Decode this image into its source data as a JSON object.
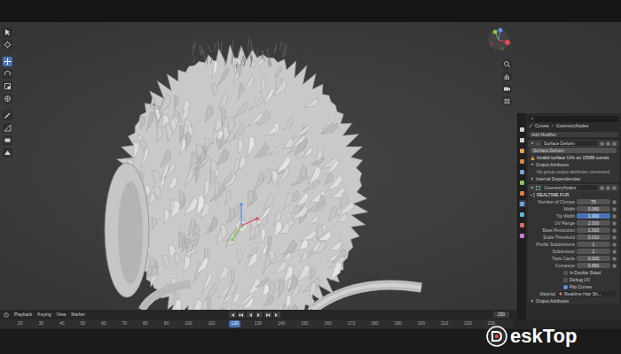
{
  "toolbar": {
    "tools": [
      {
        "selected": false
      },
      {
        "selected": false
      },
      {
        "selected": true
      },
      {
        "selected": false
      },
      {
        "selected": false
      },
      {
        "selected": false
      },
      {
        "selected": false
      },
      {
        "selected": false
      },
      {
        "selected": false
      },
      {
        "selected": false
      }
    ]
  },
  "properties": {
    "tabs": [
      {
        "color": "#cfcfcf",
        "selected": false
      },
      {
        "color": "#cfcfcf",
        "selected": false
      },
      {
        "color": "#e0a050",
        "selected": false
      },
      {
        "color": "#d08a4a",
        "selected": false
      },
      {
        "color": "#7fa4d6",
        "selected": false
      },
      {
        "color": "#8bbf6a",
        "selected": false
      },
      {
        "color": "#d87a3a",
        "selected": false
      },
      {
        "color": "#6e9ee0",
        "selected": true
      },
      {
        "color": "#5fb8d8",
        "selected": false
      },
      {
        "color": "#d46a6a",
        "selected": false
      },
      {
        "color": "#c77ad6",
        "selected": false
      }
    ],
    "breadcrumb": [
      "Curves",
      "GeometryNodes"
    ],
    "add_modifier": "Add Modifier",
    "surface_deform": {
      "name": "Surface Deform",
      "expanded": true,
      "target": "Surface Deform",
      "warning": "Invalid surface UVs on 15588 curves",
      "output_section": {
        "title": "Output Attributes",
        "expanded": true
      },
      "output_note": "No group output attributes connected",
      "dependencies": {
        "title": "Internal Dependencies",
        "expanded": false
      }
    },
    "geometry_nodes": {
      "name": "GeometryNodes",
      "expanded": true,
      "node_group": "REALTIME FUR",
      "inputs": [
        {
          "label": "Number of Clumps",
          "value": "70",
          "selected": false
        },
        {
          "label": "Width",
          "value": "0.060",
          "selected": false
        },
        {
          "label": "Tip Width",
          "value": "1.000",
          "selected": true
        },
        {
          "label": "UV Range",
          "value": "2.000",
          "selected": false
        },
        {
          "label": "Base Resolution",
          "value": "1.000",
          "selected": false
        },
        {
          "label": "Scale Threshold",
          "value": "0.010",
          "selected": false
        },
        {
          "label": "Profile Subdivisions",
          "value": "1",
          "selected": false
        },
        {
          "label": "Subdivision",
          "value": "1",
          "selected": false
        },
        {
          "label": "Twist Cards",
          "value": "0.000",
          "selected": false
        },
        {
          "label": "Curvature",
          "value": "0.660",
          "selected": false
        }
      ],
      "options": [
        {
          "label": "Is Double Sided",
          "checked": false
        },
        {
          "label": "Debug UV",
          "checked": false
        },
        {
          "label": "Flip Curves",
          "checked": true
        }
      ],
      "material": {
        "label": "Material",
        "value": "Realtime Hair Sh..."
      },
      "output_section": {
        "title": "Output Attributes",
        "expanded": false
      }
    }
  },
  "timeline": {
    "menus": [
      "Playback",
      "Keying",
      "View",
      "Marker"
    ],
    "end_frame": "250",
    "ruler": [
      {
        "label": "20",
        "selected": false
      },
      {
        "label": "30",
        "selected": false
      },
      {
        "label": "40",
        "selected": false
      },
      {
        "label": "50",
        "selected": false
      },
      {
        "label": "60",
        "selected": false
      },
      {
        "label": "70",
        "selected": false
      },
      {
        "label": "80",
        "selected": false
      },
      {
        "label": "90",
        "selected": false
      },
      {
        "label": "100",
        "selected": false
      },
      {
        "label": "110",
        "selected": false
      },
      {
        "label": "120",
        "selected": true
      },
      {
        "label": "130",
        "selected": false
      },
      {
        "label": "140",
        "selected": false
      },
      {
        "label": "150",
        "selected": false
      },
      {
        "label": "160",
        "selected": false
      },
      {
        "label": "170",
        "selected": false
      },
      {
        "label": "180",
        "selected": false
      },
      {
        "label": "190",
        "selected": false
      },
      {
        "label": "200",
        "selected": false
      },
      {
        "label": "210",
        "selected": false
      },
      {
        "label": "220",
        "selected": false
      },
      {
        "label": "230",
        "selected": false
      }
    ]
  },
  "watermark": {
    "text": "eskTop"
  }
}
